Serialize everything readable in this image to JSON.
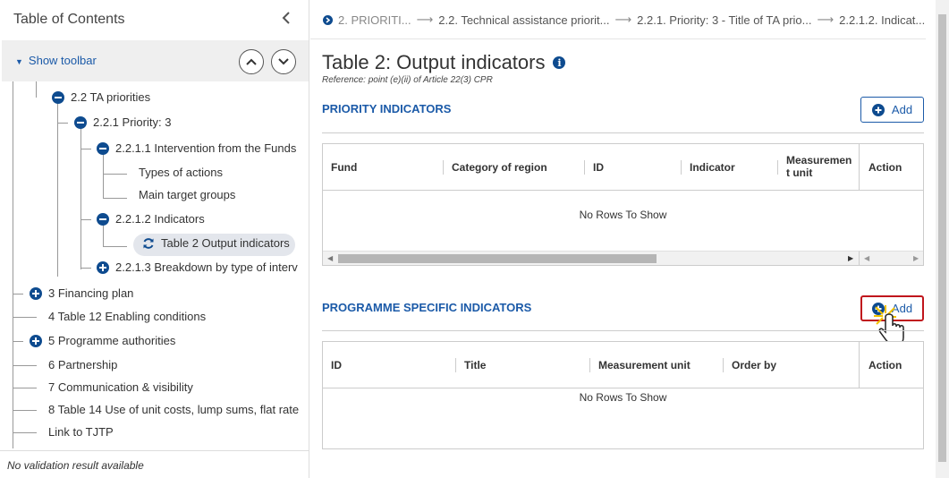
{
  "toc": {
    "title": "Table of Contents",
    "show_toolbar": "Show toolbar",
    "items": [
      {
        "label": "2.2 TA priorities",
        "icon": "minus-icon"
      },
      {
        "label": "2.2.1 Priority: 3",
        "icon": "minus-icon"
      },
      {
        "label": "2.2.1.1 Intervention from the Funds",
        "icon": "minus-icon"
      },
      {
        "label": "Types of actions"
      },
      {
        "label": "Main target groups"
      },
      {
        "label": "2.2.1.2 Indicators",
        "icon": "minus-icon"
      },
      {
        "label": "Table 2 Output indicators",
        "icon": "refresh-icon"
      },
      {
        "label": "2.2.1.3 Breakdown by type of interv",
        "icon": "plus-icon"
      },
      {
        "label": "3 Financing plan",
        "icon": "plus-icon"
      },
      {
        "label": "4 Table 12 Enabling conditions"
      },
      {
        "label": "5 Programme authorities",
        "icon": "plus-icon"
      },
      {
        "label": "6 Partnership"
      },
      {
        "label": "7 Communication & visibility"
      },
      {
        "label": "8 Table 14 Use of unit costs, lump sums, flat rate"
      },
      {
        "label": "Link to TJTP"
      }
    ],
    "status": "No validation result available"
  },
  "breadcrumb": [
    "2. PRIORITI...",
    "2.2. Technical assistance priorit...",
    "2.2.1. Priority: 3 - Title of TA prio...",
    "2.2.1.2. Indicat..."
  ],
  "page": {
    "title": "Table 2: Output indicators",
    "reference": "Reference: point (e)(ii) of Article 22(3) CPR"
  },
  "priority_indicators": {
    "title": "PRIORITY INDICATORS",
    "add_label": "Add",
    "columns": [
      "Fund",
      "Category of region",
      "ID",
      "Indicator",
      "Measuremen t unit",
      "Action"
    ],
    "empty": "No Rows To Show"
  },
  "programme_indicators": {
    "title": "PROGRAMME SPECIFIC INDICATORS",
    "add_label": "Add",
    "columns": [
      "ID",
      "Title",
      "Measurement unit",
      "Order by",
      "Action"
    ],
    "empty": "No Rows To Show"
  },
  "colors": {
    "accent": "#1b5aa8",
    "icon": "#0e4b8f",
    "highlight": "#c0161c"
  }
}
